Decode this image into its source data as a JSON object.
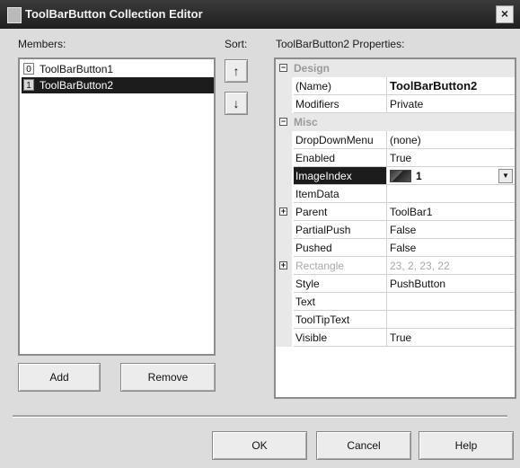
{
  "window": {
    "title": "ToolBarButton Collection Editor",
    "close_glyph": "×"
  },
  "members": {
    "label": "Members:",
    "items": [
      {
        "index": "0",
        "name": "ToolBarButton1",
        "selected": false
      },
      {
        "index": "1",
        "name": "ToolBarButton2",
        "selected": true
      }
    ],
    "add_label": "Add",
    "remove_label": "Remove"
  },
  "sort": {
    "label": "Sort:",
    "up_glyph": "↑",
    "down_glyph": "↓"
  },
  "properties": {
    "label": "ToolBarButton2  Properties:",
    "rows": {
      "cat_design": "Design",
      "name_name": "(Name)",
      "name_value": "ToolBarButton2",
      "modifiers_name": "Modifiers",
      "modifiers_value": "Private",
      "cat_misc": "Misc",
      "dropdown_name": "DropDownMenu",
      "dropdown_value": "(none)",
      "enabled_name": "Enabled",
      "enabled_value": "True",
      "imageindex_name": "ImageIndex",
      "imageindex_value": "1",
      "itemdata_name": "ItemData",
      "itemdata_value": "",
      "parent_name": "Parent",
      "parent_value": "ToolBar1",
      "partialpush_name": "PartialPush",
      "partialpush_value": "False",
      "pushed_name": "Pushed",
      "pushed_value": "False",
      "rectangle_name": "Rectangle",
      "rectangle_value": "23, 2, 23, 22",
      "style_name": "Style",
      "style_value": "PushButton",
      "text_name": "Text",
      "text_value": "",
      "tooltip_name": "ToolTipText",
      "tooltip_value": "",
      "visible_name": "Visible",
      "visible_value": "True"
    }
  },
  "footer": {
    "ok_label": "OK",
    "cancel_label": "Cancel",
    "help_label": "Help"
  },
  "colors": {
    "selection": "#1c1c1c",
    "background": "#dcdcdc",
    "titlebar": "#2a2a2a"
  }
}
